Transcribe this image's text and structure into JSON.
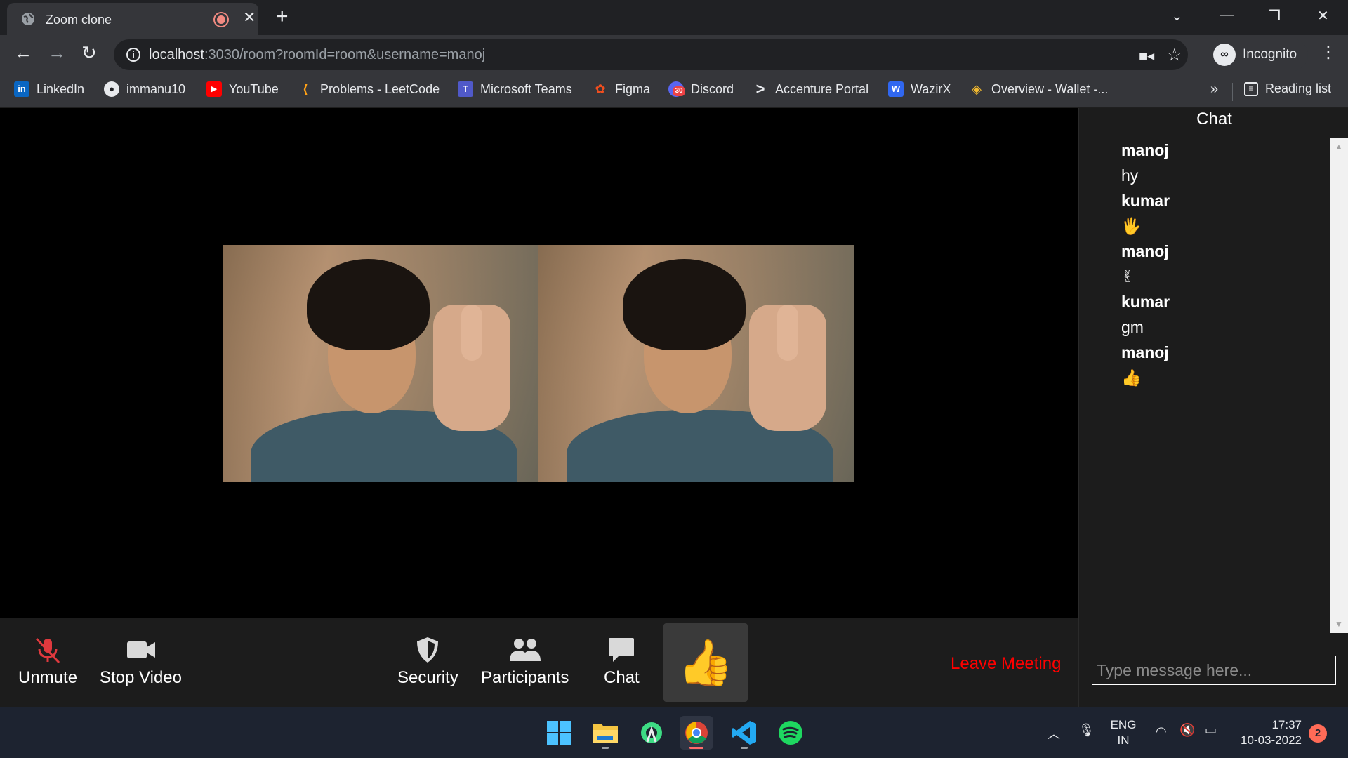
{
  "browser": {
    "tab_title": "Zoom clone",
    "url_host": "localhost",
    "url_rest": ":3030/room?roomId=room&username=manoj",
    "profile_label": "Incognito",
    "bookmarks": [
      {
        "label": "LinkedIn",
        "icon": "linkedin-icon"
      },
      {
        "label": "immanu10",
        "icon": "github-icon"
      },
      {
        "label": "YouTube",
        "icon": "youtube-icon"
      },
      {
        "label": "Problems - LeetCode",
        "icon": "leetcode-icon"
      },
      {
        "label": "Microsoft Teams",
        "icon": "teams-icon"
      },
      {
        "label": "Figma",
        "icon": "figma-icon"
      },
      {
        "label": "Discord",
        "icon": "discord-icon",
        "badge": "30"
      },
      {
        "label": "Accenture Portal",
        "icon": "accenture-icon"
      },
      {
        "label": "WazirX",
        "icon": "wazirx-icon"
      },
      {
        "label": "Overview - Wallet -...",
        "icon": "binance-icon"
      }
    ],
    "reading_list": "Reading list"
  },
  "meeting": {
    "controls": {
      "unmute": "Unmute",
      "stop_video": "Stop Video",
      "security": "Security",
      "participants": "Participants",
      "chat": "Chat",
      "reaction": "👍",
      "leave": "Leave Meeting"
    }
  },
  "chat": {
    "header": "Chat",
    "messages": [
      {
        "user": "manoj",
        "text": "hy"
      },
      {
        "user": "kumar",
        "text": "🖐"
      },
      {
        "user": "manoj",
        "text": "✌"
      },
      {
        "user": "kumar",
        "text": "gm"
      },
      {
        "user": "manoj",
        "text": "👍"
      }
    ],
    "input_placeholder": "Type message here..."
  },
  "taskbar": {
    "language_line1": "ENG",
    "language_line2": "IN",
    "time": "17:37",
    "date": "10-03-2022",
    "notification_count": "2"
  },
  "colors": {
    "leave": "#ff0000",
    "mute_icon": "#e0393e",
    "chrome_dark": "#202124",
    "chrome_toolbar": "#35363a"
  }
}
